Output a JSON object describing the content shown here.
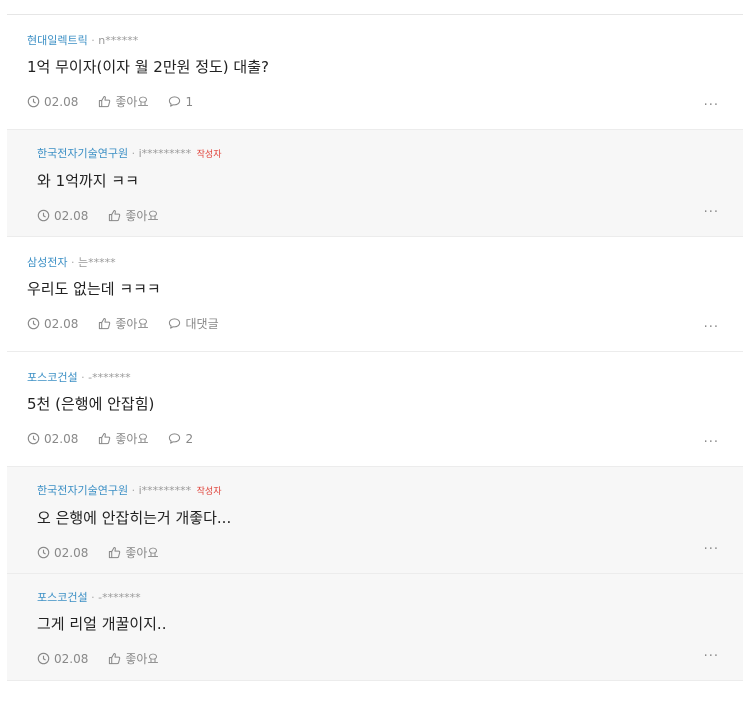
{
  "comments": [
    {
      "company": "현대일렉트릭",
      "user": "n******",
      "author_badge": "",
      "text": "1억 무이자(이자 월 2만원 정도) 대출?",
      "date": "02.08",
      "like": "좋아요",
      "reply": "1",
      "more": "..."
    },
    {
      "company": "한국전자기술연구원",
      "user": "i*********",
      "author_badge": "작성자",
      "text": "와 1억까지 ㅋㅋ",
      "date": "02.08",
      "like": "좋아요",
      "more": "..."
    },
    {
      "company": "삼성전자",
      "user": "는*****",
      "author_badge": "",
      "text": "우리도 없는데 ㅋㅋㅋ",
      "date": "02.08",
      "like": "좋아요",
      "reply": "대댓글",
      "more": "..."
    },
    {
      "company": "포스코건설",
      "user": "-*******",
      "author_badge": "",
      "text": "5천 (은행에 안잡힘)",
      "date": "02.08",
      "like": "좋아요",
      "reply": "2",
      "more": "..."
    },
    {
      "company": "한국전자기술연구원",
      "user": "i*********",
      "author_badge": "작성자",
      "text": "오 은행에 안잡히는거 개좋다...",
      "date": "02.08",
      "like": "좋아요",
      "more": "..."
    },
    {
      "company": "포스코건설",
      "user": "-*******",
      "author_badge": "",
      "text": "그게 리얼 개꿀이지..",
      "date": "02.08",
      "like": "좋아요",
      "more": "..."
    }
  ],
  "meta_separator": "·",
  "icons": {
    "time": "clock-icon",
    "like": "thumbs-up-icon",
    "reply": "speech-bubble-icon",
    "more": "ellipsis-icon"
  },
  "colors": {
    "company": "#3b8fc5",
    "author_badge": "#e0433a",
    "reply_bg": "#f7f7f7"
  }
}
